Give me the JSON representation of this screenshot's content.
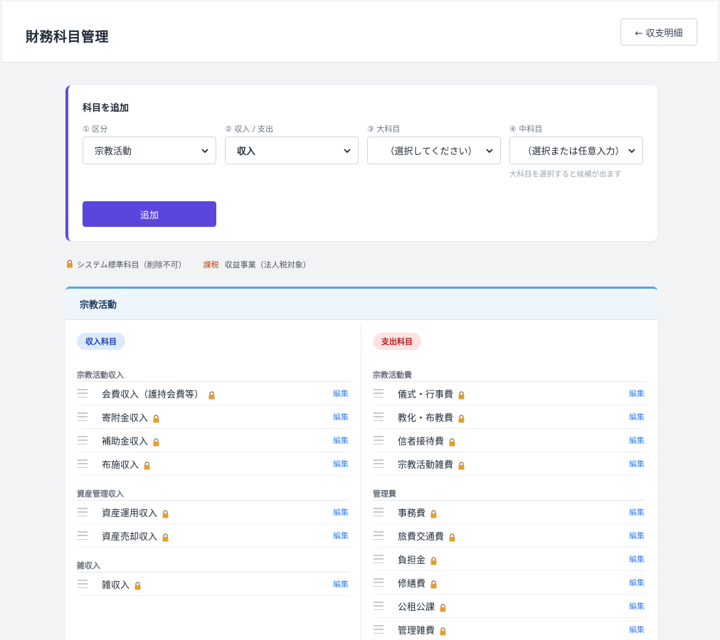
{
  "header": {
    "title": "財務科目管理",
    "back_label": "← 収支明細"
  },
  "add_form": {
    "title": "科目を追加",
    "fields": [
      {
        "label": "① 区分",
        "value": "宗教活動"
      },
      {
        "label": "② 収入 / 支出",
        "value": "収入"
      },
      {
        "label": "③ 大科目",
        "value": "（選択してください）"
      },
      {
        "label": "④ 中科目",
        "value": "（選択または任意入力）"
      }
    ],
    "hint": "大科目を選択すると候補が出ます",
    "submit_label": "追加"
  },
  "legend": {
    "system_label": "システム標準科目（削除不可）",
    "tax_badge": "課税",
    "tax_label": "収益事業（法人税対象）"
  },
  "section": {
    "title": "宗教活動",
    "edit_label": "編集",
    "income": {
      "pill": "収入科目",
      "groups": [
        {
          "label": "宗教活動収入",
          "items": [
            "会費収入（護持会費等）",
            "寄附金収入",
            "補助金収入",
            "布施収入"
          ]
        },
        {
          "label": "資産管理収入",
          "items": [
            "資産運用収入",
            "資産売却収入"
          ]
        },
        {
          "label": "雑収入",
          "items": [
            "雑収入"
          ]
        }
      ]
    },
    "expense": {
      "pill": "支出科目",
      "groups": [
        {
          "label": "宗教活動費",
          "items": [
            "儀式・行事費",
            "教化・布教費",
            "信者接待費",
            "宗教活動雑費"
          ]
        },
        {
          "label": "管理費",
          "items": [
            "事務費",
            "旅費交通費",
            "負担金",
            "修繕費",
            "公租公課",
            "管理雑費"
          ]
        }
      ]
    }
  },
  "colors": {
    "accent": "#5a45dd",
    "section_border": "#5fa3d9",
    "edit_link": "#3b82f6",
    "lock": "#e0a030"
  }
}
